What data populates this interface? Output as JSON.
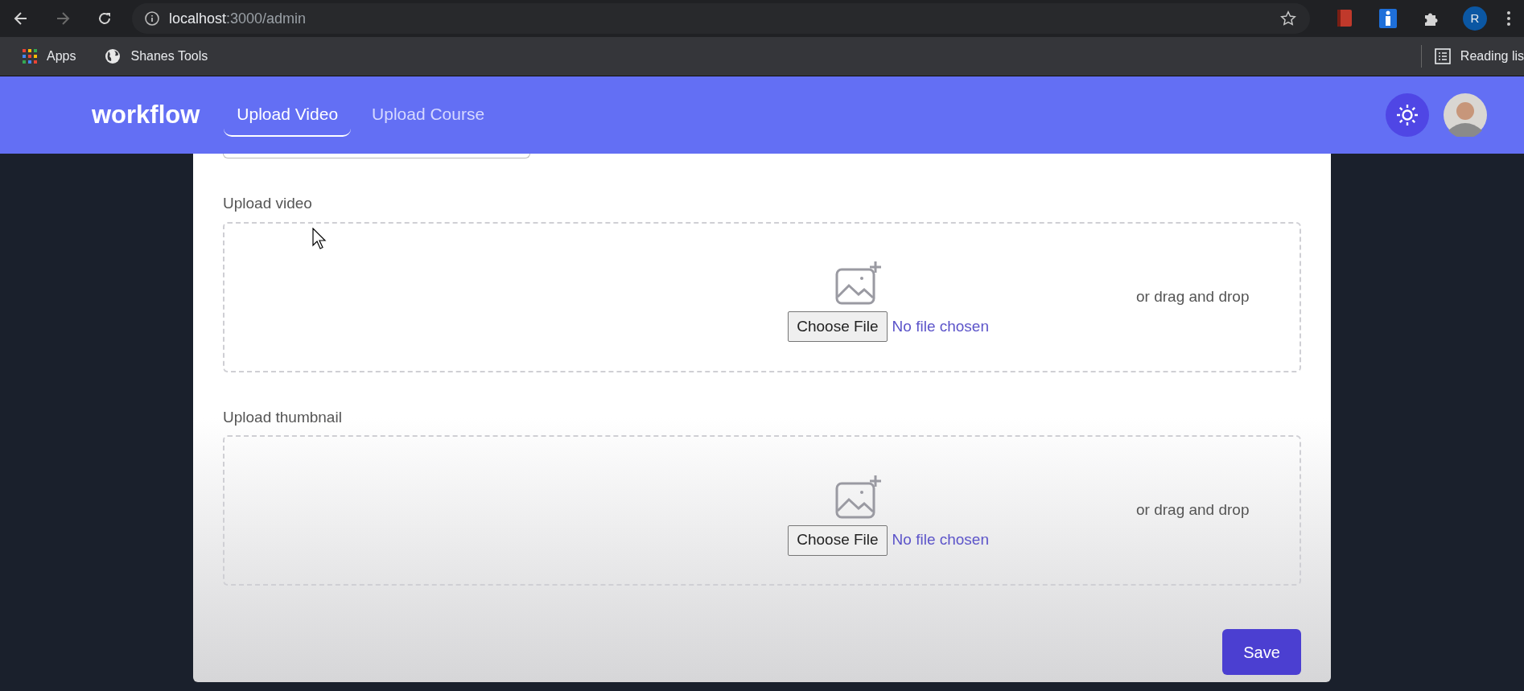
{
  "browser": {
    "url_host": "localhost",
    "url_path": ":3000/admin",
    "profile": "R",
    "bookmarks": [
      {
        "label": "Apps",
        "kind": "apps"
      },
      {
        "label": "Shanes Tools",
        "kind": "globe"
      }
    ],
    "reading_list": "Reading lis"
  },
  "header": {
    "logo": "workflow",
    "tabs": [
      {
        "label": "Upload Video",
        "selected": true
      },
      {
        "label": "Upload Course",
        "selected": false
      }
    ]
  },
  "uploads": [
    {
      "label": "Upload video",
      "button": "Choose File",
      "status": "No file chosen",
      "hint": "or drag and drop"
    },
    {
      "label": "Upload thumbnail",
      "button": "Choose File",
      "status": "No file chosen",
      "hint": "or drag and drop"
    }
  ],
  "save_button": "Save"
}
